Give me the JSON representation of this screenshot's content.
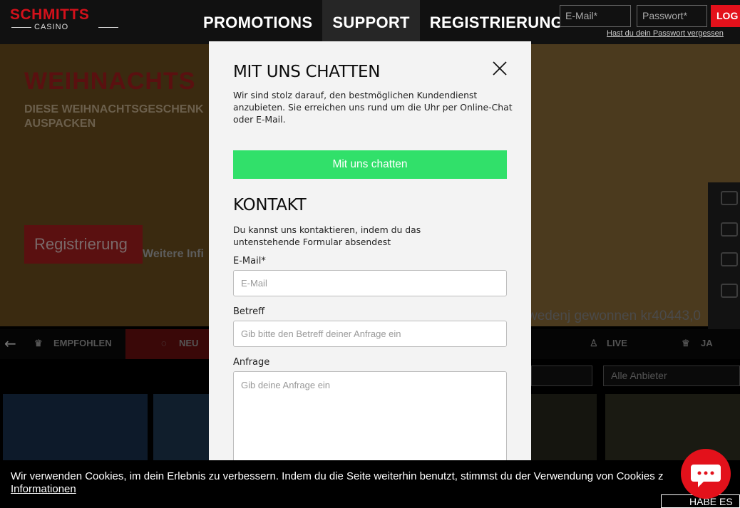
{
  "header": {
    "logo_brand": "SCHMITTS",
    "logo_sub": "CASINO",
    "nav": [
      "PROMOTIONS",
      "SUPPORT",
      "REGISTRIERUNG"
    ],
    "active_nav": "SUPPORT",
    "email_placeholder": "E-Mail*",
    "password_placeholder": "Passwort*",
    "login_label": "LOG",
    "forgot_link": "Hast du dein Passwort vergessen"
  },
  "hero": {
    "title": "WEIHNACHTS",
    "subtitle": "DIESE WEIHNACHTSGESCHENK AUSPACKEN",
    "register_button": "Registrierung",
    "more_info": "Weitere Infi",
    "winner_ticker": "wedenj  gewonnen kr40443,0"
  },
  "categories": {
    "items": [
      "EMPFOHLEN",
      "NEU",
      "LIVE",
      "JA"
    ],
    "provider_filter": "Alle Anbieter"
  },
  "modal": {
    "chat_title": "MIT UNS CHATTEN",
    "chat_text": "Wir sind stolz darauf, den bestmöglichen Kundendienst anzubieten. Sie erreichen uns rund um die Uhr per Online-Chat oder E-Mail.",
    "chat_button": "Mit uns chatten",
    "contact_title": "KONTAKT",
    "contact_text": "Du kannst uns kontaktieren, indem du das untenstehende Formular absendest",
    "email_label": "E-Mail*",
    "email_placeholder": "E-Mail",
    "subject_label": "Betreff",
    "subject_placeholder": "Gib bitte den Betreff deiner Anfrage ein",
    "request_label": "Anfrage",
    "request_placeholder": "Gib deine Anfrage ein"
  },
  "cookie": {
    "text": "Wir verwenden Cookies, im dein Erlebnis zu verbessern. Indem du die Seite weiterhin benutzt, stimmst du der Verwendung von Cookies z",
    "link": "Informationen",
    "button": "HABE ES"
  },
  "colors": {
    "brand_red": "#e3111b",
    "chat_green": "#31e06a"
  }
}
